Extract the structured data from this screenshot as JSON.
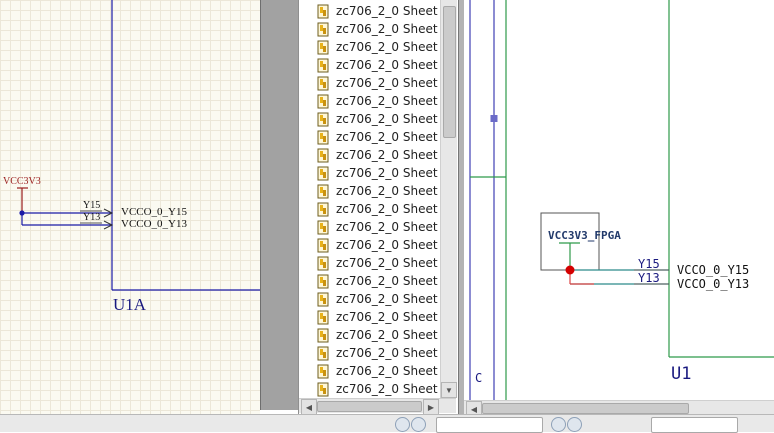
{
  "left_schematic": {
    "power_label": "VCC3V3",
    "pin_y15": "Y15",
    "pin_y13": "Y13",
    "net_vcco_y15": "VCCO_0_Y15",
    "net_vcco_y13": "VCCO_0_Y13",
    "component_ref": "U1A"
  },
  "sheet_list": {
    "icon": "schematic-sheet-icon",
    "items": [
      "zc706_2_0 Sheet",
      "zc706_2_0 Sheet",
      "zc706_2_0 Sheet",
      "zc706_2_0 Sheet",
      "zc706_2_0 Sheet",
      "zc706_2_0 Sheet",
      "zc706_2_0 Sheet",
      "zc706_2_0 Sheet",
      "zc706_2_0 Sheet",
      "zc706_2_0 Sheet",
      "zc706_2_0 Sheet",
      "zc706_2_0 Sheet",
      "zc706_2_0 Sheet",
      "zc706_2_0 Sheet",
      "zc706_2_0 Sheet",
      "zc706_2_0 Sheet",
      "zc706_2_0 Sheet",
      "zc706_2_0 Sheet",
      "zc706_2_0 Sheet",
      "zc706_2_0 Sheet",
      "zc706_2_0 Sheet",
      "zc706_2_0 Sheet"
    ]
  },
  "right_schematic": {
    "port_label": "VCC3V3_FPGA",
    "pin_y15": "Y15",
    "pin_y13": "Y13",
    "net_vcco_y15": "VCCO_0_Y15",
    "net_vcco_y13": "VCCO_0_Y13",
    "component_ref": "U1",
    "letter_c": "C"
  },
  "colors": {
    "wire_dark_blue": "#1a1aa6",
    "power_red": "#9a1d1d",
    "wire_green": "#2e9a4a",
    "wire_teal": "#2c8a8a",
    "junction_red": "#d40000"
  }
}
